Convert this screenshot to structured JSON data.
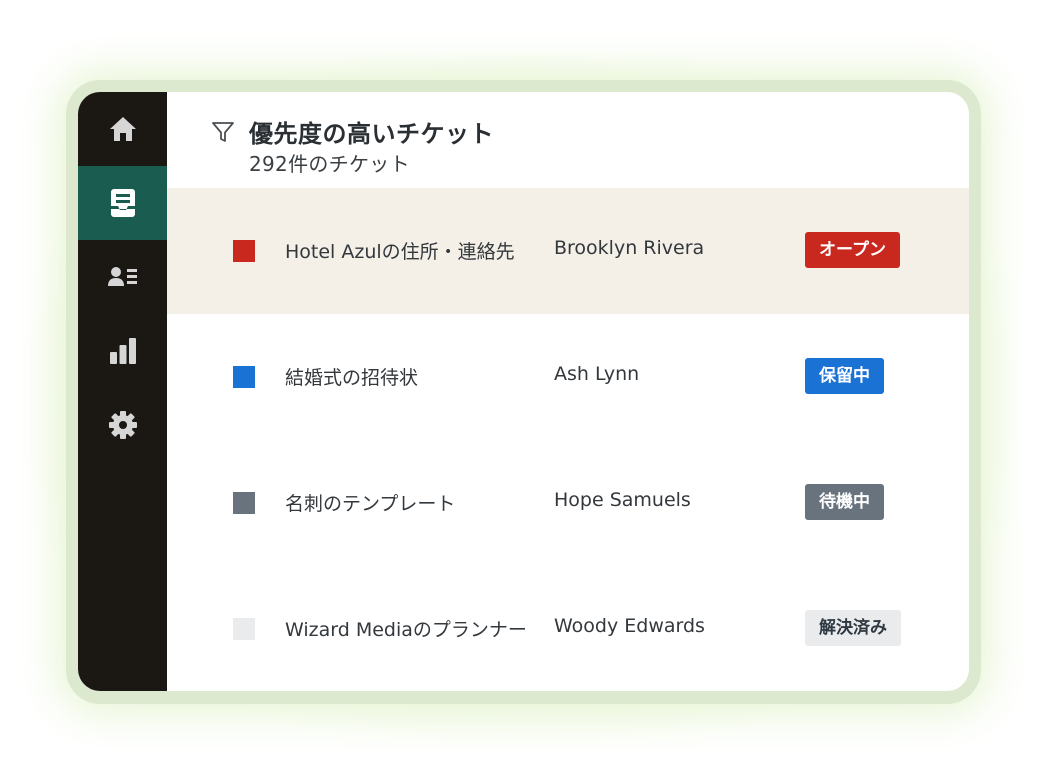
{
  "sidebar": {
    "items": [
      {
        "name": "home",
        "icon": "home-icon",
        "active": false
      },
      {
        "name": "tickets",
        "icon": "inbox-icon",
        "active": true
      },
      {
        "name": "contacts",
        "icon": "contact-card-icon",
        "active": false
      },
      {
        "name": "reports",
        "icon": "bar-chart-icon",
        "active": false
      },
      {
        "name": "settings",
        "icon": "gear-icon",
        "active": false
      }
    ]
  },
  "header": {
    "filter_icon": "filter-icon",
    "title": "優先度の高いチケット",
    "subtitle": "292件のチケット"
  },
  "tickets": [
    {
      "title": "Hotel Azulの住所・連絡先",
      "assignee": "Brooklyn Rivera",
      "status": "オープン",
      "color": "#c8281e",
      "badge_bg": "#c8281e",
      "badge_fg": "#ffffff",
      "highlighted": true
    },
    {
      "title": "結婚式の招待状",
      "assignee": "Ash Lynn",
      "status": "保留中",
      "color": "#1a73d4",
      "badge_bg": "#1a73d4",
      "badge_fg": "#ffffff",
      "highlighted": false
    },
    {
      "title": "名刺のテンプレート",
      "assignee": "Hope Samuels",
      "status": "待機中",
      "color": "#68737d",
      "badge_bg": "#68737d",
      "badge_fg": "#ffffff",
      "highlighted": false
    },
    {
      "title": "Wizard Mediaのプランナー",
      "assignee": "Woody Edwards",
      "status": "解決済み",
      "color": "#e9ebed",
      "badge_bg": "#e9ebed",
      "badge_fg": "#2f3941",
      "highlighted": false
    }
  ]
}
